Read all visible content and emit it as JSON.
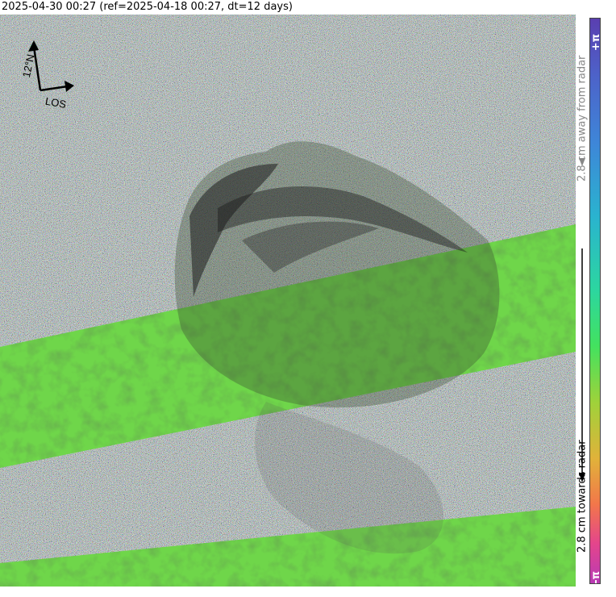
{
  "title": "2025-04-30 00:27 (ref=2025-04-18 00:27, dt=12 days)",
  "compass": {
    "north_label": "12°N",
    "los_label": "LOS"
  },
  "colorbar": {
    "top_label": "+π",
    "bottom_label": "-π",
    "away_text": "2.8 cm away from radar",
    "towards_text": "2.8 cm towards radar",
    "colors": [
      "#5a3fb0",
      "#3e86d8",
      "#2ab3cf",
      "#2cd6a0",
      "#43e25f",
      "#9fd23a",
      "#e1b23a",
      "#f2774a",
      "#e4458c",
      "#b93ab5"
    ]
  },
  "map": {
    "layers": [
      "interferogram-phase",
      "coherent-band",
      "hillshade"
    ],
    "band_color": "#6fd64a",
    "noise_color": "#8a8a8a"
  }
}
